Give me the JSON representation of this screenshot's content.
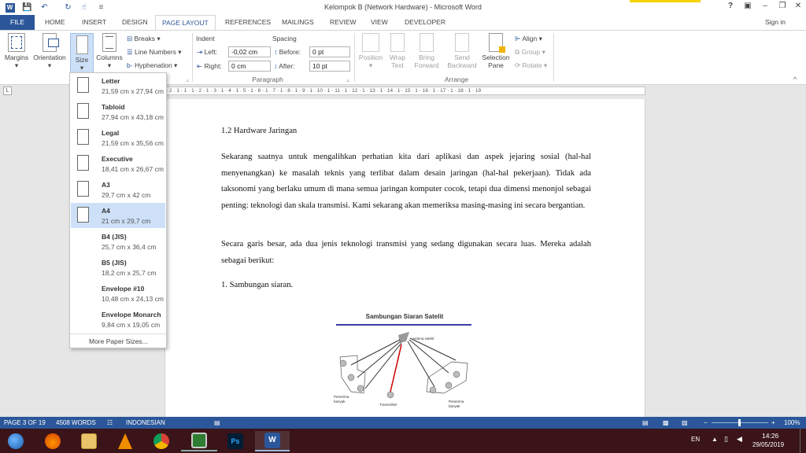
{
  "titlebar": {
    "title": "Kelompok B (Network Hardware) - Microsoft Word",
    "help": "?",
    "signin": "Sign in"
  },
  "tabs": [
    "FILE",
    "HOME",
    "INSERT",
    "DESIGN",
    "PAGE LAYOUT",
    "REFERENCES",
    "MAILINGS",
    "REVIEW",
    "VIEW",
    "DEVELOPER"
  ],
  "ribbon": {
    "margins": "Margins",
    "orientation": "Orientation",
    "size": "Size",
    "columns": "Columns",
    "breaks": "Breaks",
    "line_numbers": "Line Numbers",
    "hyphenation": "Hyphenation",
    "indent_label": "Indent",
    "spacing_label": "Spacing",
    "left_label": "Left:",
    "left_value": "-0,02 cm",
    "right_label": "Right:",
    "right_value": "0 cm",
    "before_label": "Before:",
    "before_value": "0 pt",
    "after_label": "After:",
    "after_value": "10 pt",
    "paragraph_group": "Paragraph",
    "position": "Position",
    "wrap_text": "Wrap Text",
    "bring_forward": "Bring Forward",
    "send_backward": "Send Backward",
    "selection_pane": "Selection Pane",
    "align": "Align",
    "group": "Group",
    "rotate": "Rotate",
    "arrange_group": "Arrange"
  },
  "ruler": {
    "marks": "· 2 · 1 · 1 · 1 · 2 · 1 · 3 · 1 · 4 · 1 · 5 · 1 · 6 · 1 · 7 · 1 · 8 · 1 · 9 · 1 · 10 · 1 · 11 · 1 · 12 · 1 · 13 · 1 · 14 · 1 · 15 · 1 · 16 · 1 · 17 · 1 · 18 · 1 · 19"
  },
  "size_menu": {
    "items": [
      {
        "name": "Letter",
        "dim": "21,59 cm x 27,94 cm"
      },
      {
        "name": "Tabloid",
        "dim": "27,94 cm x 43,18 cm"
      },
      {
        "name": "Legal",
        "dim": "21,59 cm x 35,56 cm"
      },
      {
        "name": "Executive",
        "dim": "18,41 cm x 26,67 cm"
      },
      {
        "name": "A3",
        "dim": "29,7 cm x 42 cm"
      },
      {
        "name": "A4",
        "dim": "21 cm x 29,7 cm"
      },
      {
        "name": "B4 (JIS)",
        "dim": "25,7 cm x 36,4 cm"
      },
      {
        "name": "B5 (JIS)",
        "dim": "18,2 cm x 25,7 cm"
      },
      {
        "name": "Envelope #10",
        "dim": "10,48 cm x 24,13 cm"
      },
      {
        "name": "Envelope Monarch",
        "dim": "9,84 cm x 19,05 cm"
      }
    ],
    "selected": "A4",
    "more": "More Paper Sizes..."
  },
  "document": {
    "heading": "1.2 Hardware Jaringan",
    "para1": "Sekarang saatnya untuk mengalihkan perhatian kita dari aplikasi dan aspek jejaring sosial (hal-hal menyenangkan) ke masalah teknis yang terlibat dalam desain jaringan (hal-hal pekerjaan). Tidak ada taksonomi yang berlaku umum di mana semua jaringan komputer cocok, tetapi dua dimensi menonjol sebagai penting: teknologi dan skala transmisi. Kami sekarang akan memeriksa masing-masing ini secara bergantian.",
    "para2": "Secara garis besar, ada dua jenis teknologi transmisi yang sedang digunakan secara luas. Mereka adalah sebagai berikut:",
    "item1": "1. Sambungan siaran.",
    "figure": {
      "title": "Sambungan Siaran Satelit",
      "antenna": "Antena satelit",
      "left_recv": "Penerima banyak",
      "transmitter": "Transmitter",
      "right_recv": "Penerima banyak"
    }
  },
  "status": {
    "page": "PAGE 3 OF 19",
    "words": "4508 WORDS",
    "language": "INDONESIAN",
    "zoom": "100%"
  },
  "taskbar": {
    "lang": "EN",
    "time": "14:26",
    "date": "29/05/2019"
  },
  "colors": {
    "accent": "#2b579a",
    "selected": "#cde0f7",
    "taskbar": "#3a1418"
  }
}
